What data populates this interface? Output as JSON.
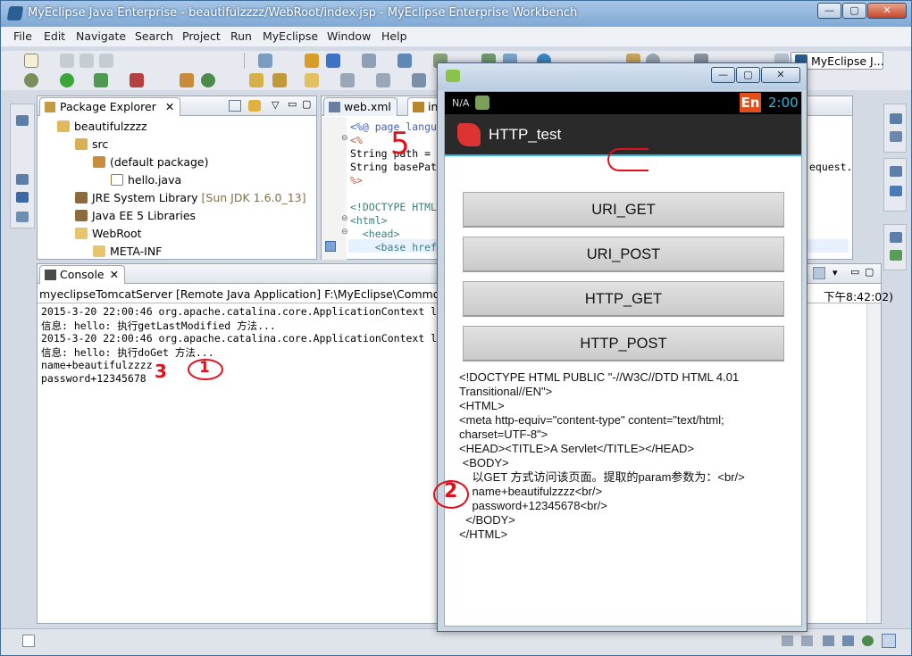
{
  "window": {
    "title": "MyEclipse Java Enterprise - beautifulzzzz/WebRoot/index.jsp - MyEclipse Enterprise Workbench",
    "minimize": "—",
    "maximize": "▢",
    "close": "✕"
  },
  "menu": [
    "File",
    "Edit",
    "Navigate",
    "Search",
    "Project",
    "Run",
    "MyEclipse",
    "Window",
    "Help"
  ],
  "perspective": {
    "label": "MyEclipse J..."
  },
  "package_explorer": {
    "tab": "Package Explorer",
    "items": [
      {
        "label": "beautifulzzzz",
        "extra": ""
      },
      {
        "label": "src",
        "extra": ""
      },
      {
        "label": "(default package)",
        "extra": ""
      },
      {
        "label": "hello.java",
        "extra": ""
      },
      {
        "label": "JRE System Library",
        "extra": "[Sun JDK 1.6.0_13]"
      },
      {
        "label": "Java EE 5 Libraries",
        "extra": ""
      },
      {
        "label": "WebRoot",
        "extra": ""
      },
      {
        "label": "META-INF",
        "extra": ""
      }
    ]
  },
  "editor": {
    "tabs": [
      "web.xml",
      "in"
    ],
    "lines": [
      "<%@ page langu",
      "<%",
      "String path =",
      "String basePat",
      "%>",
      "",
      "<!DOCTYPE HTML",
      "<html>",
      "  <head>",
      "    <base href"
    ],
    "right_fragment": "equest."
  },
  "console": {
    "tab": "Console",
    "header": "myeclipseTomcatServer [Remote Java Application] F:\\MyEclipse\\Common\\bin",
    "header_right": "下午8:42:02)",
    "lines": [
      "2015-3-20 22:00:46 org.apache.catalina.core.ApplicationContext l",
      "信息: hello: 执行getLastModified 方法...",
      "2015-3-20 22:00:46 org.apache.catalina.core.ApplicationContext l",
      "信息: hello: 执行doGet 方法...",
      "name+beautifulzzzz",
      "password+12345678"
    ]
  },
  "emulator": {
    "status": {
      "left": "N/A",
      "time": "2:00",
      "badge": "En"
    },
    "app_title": "HTTP_test",
    "buttons": [
      "URI_GET",
      "URI_POST",
      "HTTP_GET",
      "HTTP_POST"
    ],
    "response": "<!DOCTYPE HTML PUBLIC \"-//W3C//DTD HTML 4.01\nTransitional//EN\">\n<HTML>\n<meta http-equiv=\"content-type\" content=\"text/html;\ncharset=UTF-8\">\n<HEAD><TITLE>A Servlet</TITLE></HEAD>\n <BODY>\n    以GET 方式访问该页面。提取的param参数为：<br/>\n    name+beautifulzzzz<br/>\n    password+12345678<br/>\n  </BODY>\n</HTML>"
  },
  "annotations": {
    "one": "1",
    "two": "2",
    "three": "3",
    "five": "5"
  },
  "colors": {
    "accent": "#33b5e5",
    "annotation": "#e0101a"
  }
}
